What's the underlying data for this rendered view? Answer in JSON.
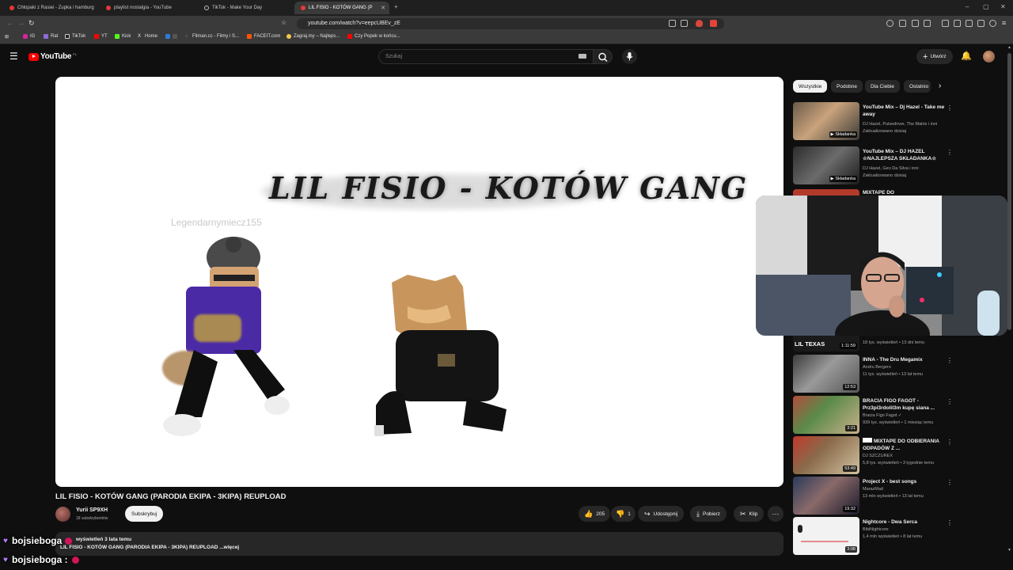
{
  "browser": {
    "tabs": [
      {
        "title": "Chłopaki z Rasiei - Zupka i hamburg",
        "icon": "youtube-icon",
        "active": false
      },
      {
        "title": "playlist nostalgia - YouTube",
        "icon": "youtube-icon",
        "active": false
      },
      {
        "title": "TikTok - Make Your Day",
        "icon": "tiktok-icon",
        "active": false
      },
      {
        "title": "LIL FISIO - KOTÓW GANG (P",
        "icon": "youtube-icon",
        "active": true
      }
    ],
    "url": "youtube.com/watch?v=eepcUBEv_zE",
    "bookmarks": [
      "IG",
      "Rat",
      "TikTok",
      "YT",
      "Kick",
      "Home",
      "Filman.cc - Filmy i S...",
      "FACEIT.com",
      "Zagraj.my – Najleps...",
      "Czy Popek w końcu..."
    ]
  },
  "youtube": {
    "logo_text": "YouTube",
    "logo_region": "PL",
    "search_placeholder": "Szukaj",
    "create_label": "Utwórz"
  },
  "video": {
    "overlay_title": "LIL FISIO - KOTÓW GANG",
    "watermark": "Legendarnymiecz155",
    "title": "LIL FISIO - KOTÓW GANG (PARODIA EKIPA - 3KIPA) REUPLOAD",
    "channel": "Yurii SP9XH",
    "subscribers": "18 subskrybentów",
    "subscribe_label": "Subskrybuj",
    "likes": "205",
    "dislikes": "1",
    "share_label": "Udostępnij",
    "download_label": "Pobierz",
    "clip_label": "Klip",
    "description_meta": "wyświetleń  3 lata temu",
    "description_text": "LIL FISIO - KOTÓW GANG (PARODIA EKIPA - 3KIPA) REUPLOAD ...więcej"
  },
  "filters": [
    "Wszystkie",
    "Podobne",
    "Dla Ciebie",
    "Ostatnio"
  ],
  "recommendations": [
    {
      "title": "YouTube Mix – Dj Hazel - Take me away",
      "channel": "DJ Hazel, Pulsedriver, The Matrix i inni",
      "meta": "Zaktualizowano dzisiaj",
      "badge": "Składanka",
      "duration": ""
    },
    {
      "title": "YouTube Mix – DJ HAZEL ☆NAJLEPSZA SKŁADANKA☆",
      "channel": "DJ Hazel, Geo Da Silva i inni",
      "meta": "Zaktualizowano dzisiaj",
      "badge": "Składanka",
      "duration": ""
    },
    {
      "title": "MIXTAPE DO",
      "channel": "",
      "meta": "",
      "badge": "",
      "duration": ""
    },
    {
      "title": "",
      "channel": "",
      "meta": "18 tys. wyświetleń • 13 dni temu",
      "badge": "",
      "duration": "1:11:59",
      "thumb_text": "LIL TEXAS"
    },
    {
      "title": "INNA - The Dru Megamix",
      "channel": "Andru Bergero",
      "meta": "11 tys. wyświetleń • 13 lat temu",
      "badge": "",
      "duration": "12:53"
    },
    {
      "title": "BRACIA FIGO FAGOT - Prz3pi3rdolil3m kupę siana ...",
      "channel": "Bracia Figo Fagot ✓",
      "meta": "939 tys. wyświetleń • 1 miesiąc temu",
      "badge": "",
      "duration": "3:21"
    },
    {
      "title": "MIXTAPE DO ODBIERANIA ODPADÓW Z ...",
      "channel": "DJ SZCZUREX",
      "meta": "5,8 tys. wyświetleń • 3 tygodnie temu",
      "badge": "",
      "duration": "53:49"
    },
    {
      "title": "Project X - best songs",
      "channel": "MarazMad",
      "meta": "13 mln wyświetleń • 13 lat temu",
      "badge": "",
      "duration": "19:32"
    },
    {
      "title": "Nightcore - Dwa Serca",
      "channel": "BibiNightcore",
      "meta": "1,4 mln wyświetleń • 8 lat temu",
      "badge": "",
      "duration": "3:08"
    }
  ],
  "chat": [
    {
      "user": "bojsieboga",
      "text": ""
    },
    {
      "user": "bojsieboga :",
      "text": ""
    }
  ],
  "colors": {
    "yt_red": "#ff0000",
    "background": "#0f0f0f",
    "chip": "#272727",
    "chat_heart": "#b57cff"
  }
}
